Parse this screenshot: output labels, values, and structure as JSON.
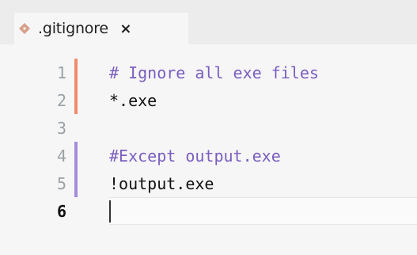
{
  "tab": {
    "title": ".gitignore",
    "icon": "gitignore-file-icon",
    "close_label": "×"
  },
  "editor": {
    "lines": [
      {
        "number": "1",
        "text": "# Ignore all exe files",
        "comment": true,
        "marker": "orange"
      },
      {
        "number": "2",
        "text": "*.exe",
        "comment": false,
        "marker": "orange"
      },
      {
        "number": "3",
        "text": "",
        "comment": false,
        "marker": "none"
      },
      {
        "number": "4",
        "text": "#Except output.exe",
        "comment": true,
        "marker": "purple"
      },
      {
        "number": "5",
        "text": "!output.exe",
        "comment": false,
        "marker": "purple"
      },
      {
        "number": "6",
        "text": "",
        "comment": false,
        "marker": "none"
      }
    ],
    "active_line": "6"
  },
  "colors": {
    "comment": "#7a5ec0",
    "marker_orange": "#ef8b6a",
    "marker_purple": "#a58bdc",
    "file_icon": "#d7a08a"
  }
}
